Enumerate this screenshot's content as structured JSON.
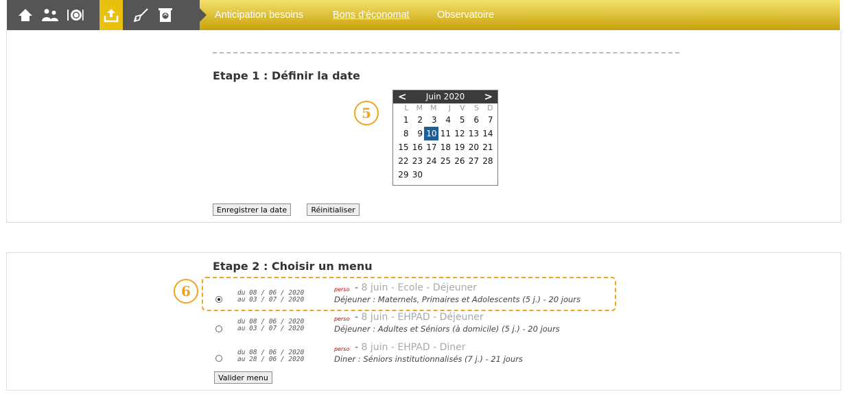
{
  "nav": {
    "icons": [
      "home-icon",
      "users-icon",
      "plate-icon",
      "upload-icon",
      "broom-icon",
      "recycle-bin-icon"
    ],
    "links": [
      "Anticipation besoins",
      "Bons d'économat",
      "Observatoire"
    ]
  },
  "step1": {
    "title": "Etape 1 : Définir la date",
    "badge": "5",
    "calendar": {
      "prev": "<",
      "next": ">",
      "month": "Juin 2020",
      "weekdays": [
        "L",
        "M",
        "M",
        "J",
        "V",
        "S",
        "D"
      ],
      "days": [
        "1",
        "2",
        "3",
        "4",
        "5",
        "6",
        "7",
        "8",
        "9",
        "10",
        "11",
        "12",
        "13",
        "14",
        "15",
        "16",
        "17",
        "18",
        "19",
        "20",
        "21",
        "22",
        "23",
        "24",
        "25",
        "26",
        "27",
        "28",
        "29",
        "30"
      ],
      "selected_day": "10"
    },
    "save_label": "Enregistrer la date",
    "reset_label": "Réinitialiser"
  },
  "step2": {
    "title": "Etape 2 : Choisir un menu",
    "badge": "6",
    "menus": [
      {
        "from": "du 08 / 06 / 2020",
        "to": "au 03 / 07 / 2020",
        "tag": "perso",
        "dash": "-",
        "name": "8 juin - Ecole - Déjeuner",
        "desc": "Déjeuner : Maternels, Primaires et Adolescents (5 j.) - 20 jours",
        "checked": true
      },
      {
        "from": "du 08 / 06 / 2020",
        "to": "au 03 / 07 / 2020",
        "tag": "perso",
        "dash": "-",
        "name": "8 juin - EHPAD - Déjeuner",
        "desc": "Déjeuner : Adultes et Séniors (à domicile) (5 j.) - 20 jours",
        "checked": false
      },
      {
        "from": "du 08 / 06 / 2020",
        "to": "au 28 / 06 / 2020",
        "tag": "perso",
        "dash": "-",
        "name": "8 juin - EHPAD - Diner",
        "desc": "Diner : Séniors institutionnalisés (7 j.) - 21 jours",
        "checked": false
      }
    ],
    "validate_label": "Valider menu"
  },
  "colors": {
    "accent": "#e8c10f",
    "callout": "#f2a31b",
    "selected_day": "#1f5f98",
    "tag": "#c00000"
  }
}
